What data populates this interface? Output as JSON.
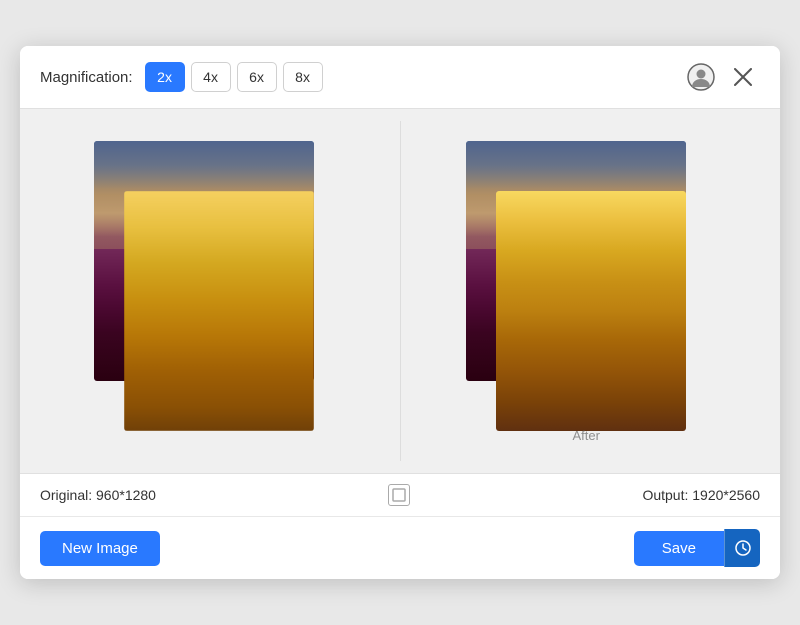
{
  "header": {
    "magnification_label": "Magnification:",
    "mag_options": [
      {
        "label": "2x",
        "value": "2x",
        "active": true
      },
      {
        "label": "4x",
        "value": "4x",
        "active": false
      },
      {
        "label": "6x",
        "value": "6x",
        "active": false
      },
      {
        "label": "8x",
        "value": "8x",
        "active": false
      }
    ]
  },
  "image_area": {
    "original_label": "Original: 960*1280",
    "output_label": "Output: 1920*2560",
    "after_text": "After"
  },
  "footer": {
    "new_image_label": "New Image",
    "save_label": "Save"
  },
  "colors": {
    "accent": "#2979ff",
    "accent_dark": "#1565c0"
  }
}
